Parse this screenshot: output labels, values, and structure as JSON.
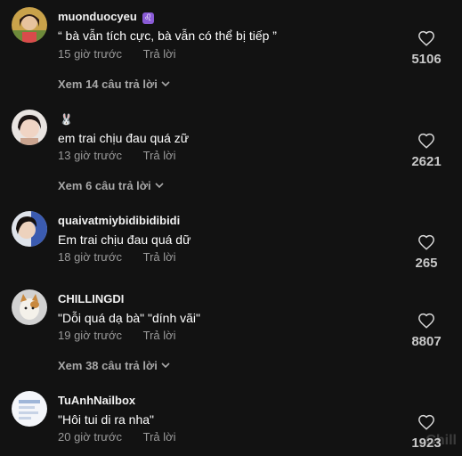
{
  "theme": {
    "background": "#121212",
    "text_primary": "#ffffff",
    "text_secondary": "#9a9a9a",
    "zodiac_badge": "#8a5bd6"
  },
  "comments": [
    {
      "username": "muonduocyeu",
      "badge": "♌",
      "text": "“ bà vẫn tích cực, bà vẫn có thể bị tiếp ”",
      "time": "15 giờ trước",
      "reply_label": "Trả lời",
      "likes": "5106",
      "view_replies": "Xem 14 câu trả lời"
    },
    {
      "username": "",
      "badge": "🐰",
      "text": "em trai chịu đau quá zữ",
      "time": "13 giờ trước",
      "reply_label": "Trả lời",
      "likes": "2621",
      "view_replies": "Xem 6 câu trả lời"
    },
    {
      "username": "quaivatmiybidibidibidi",
      "text": "Em trai chịu đau quá dữ",
      "time": "18 giờ trước",
      "reply_label": "Trả lời",
      "likes": "265"
    },
    {
      "username": "CHILLINGDI",
      "text": "\"Dỗi quá dạ bà\" \"dính vãi\"",
      "time": "19 giờ trước",
      "reply_label": "Trả lời",
      "likes": "8807",
      "view_replies": "Xem 38 câu trả lời"
    },
    {
      "username": "TuAnhNailbox",
      "text": "\"Hôi tui di ra nha\"",
      "time": "20 giờ trước",
      "reply_label": "Trả lời",
      "likes": "1923"
    }
  ],
  "watermark": "Chill"
}
